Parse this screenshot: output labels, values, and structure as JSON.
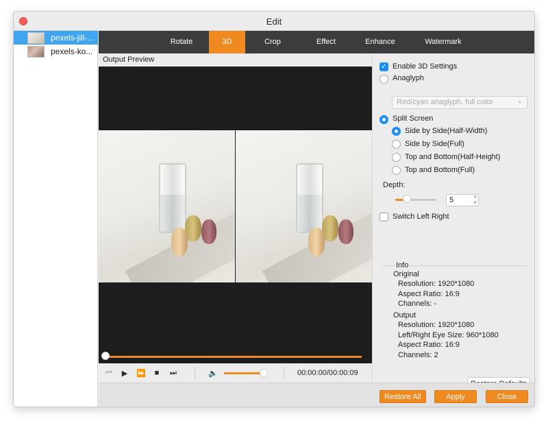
{
  "window": {
    "title": "Edit"
  },
  "sidebar": {
    "files": [
      {
        "label": "pexels-jill-...",
        "selected": true
      },
      {
        "label": "pexels-ko...",
        "selected": false
      }
    ]
  },
  "tabs": [
    {
      "label": "Rotate",
      "active": false
    },
    {
      "label": "3D",
      "active": true
    },
    {
      "label": "Crop",
      "active": false
    },
    {
      "label": "Effect",
      "active": false
    },
    {
      "label": "Enhance",
      "active": false
    },
    {
      "label": "Watermark",
      "active": false
    }
  ],
  "preview": {
    "label": "Output Preview",
    "timecode": "00:00:00/00:00:09",
    "seek_progress": 0.0,
    "volume_level": 0.85
  },
  "settings": {
    "enable_3d": {
      "label": "Enable 3D Settings",
      "checked": true
    },
    "anaglyph": {
      "label": "Anaglyph",
      "selected": false
    },
    "anaglyph_select": {
      "value": "Red/cyan anaglyph, full color"
    },
    "split_screen": {
      "label": "Split Screen",
      "selected": true
    },
    "split_options": [
      {
        "label": "Side by Side(Half-Width)",
        "selected": true
      },
      {
        "label": "Side by Side(Full)",
        "selected": false
      },
      {
        "label": "Top and Bottom(Half-Height)",
        "selected": false
      },
      {
        "label": "Top and Bottom(Full)",
        "selected": false
      }
    ],
    "depth": {
      "label": "Depth:",
      "value": "5",
      "level": 0.25
    },
    "switch_left_right": {
      "label": "Switch Left Right",
      "checked": false
    },
    "info": {
      "heading": "Info",
      "original": {
        "heading": "Original",
        "resolution": "Resolution: 1920*1080",
        "aspect": "Aspect Ratio: 16:9",
        "channels": "Channels: -"
      },
      "output": {
        "heading": "Output",
        "resolution": "Resolution: 1920*1080",
        "eye_size": "Left/Right Eye Size: 960*1080",
        "aspect": "Aspect Ratio: 16:9",
        "channels": "Channels: 2"
      }
    },
    "restore_defaults": "Restore Defaults"
  },
  "footer": {
    "restore_all": "Restore All",
    "apply": "Apply",
    "close": "Close"
  },
  "colors": {
    "accent": "#ef8a20",
    "selection": "#3fa5ee",
    "check": "#1b8ef2"
  }
}
